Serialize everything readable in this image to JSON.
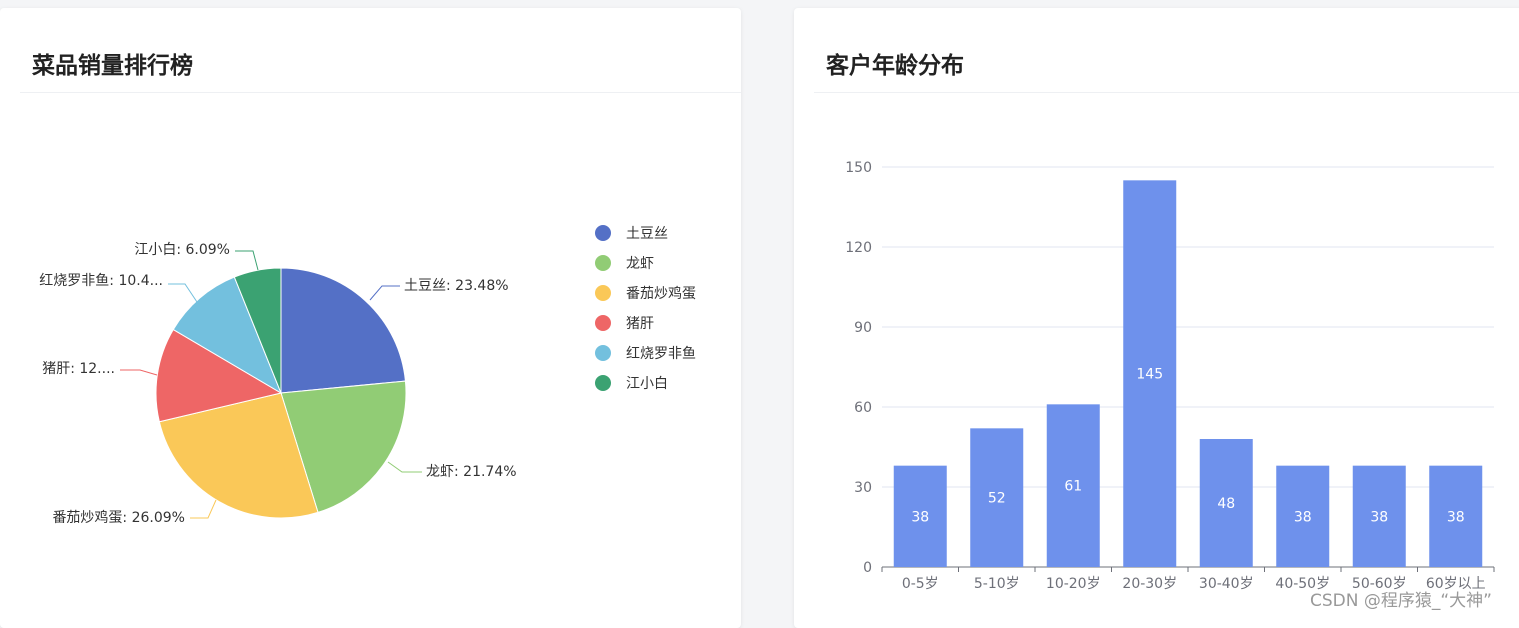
{
  "left_card": {
    "title": "菜品销量排行榜"
  },
  "right_card": {
    "title": "客户年龄分布"
  },
  "watermark": "CSDN @程序猿_“大神”",
  "chart_data": [
    {
      "type": "pie",
      "title": "菜品销量排行榜",
      "legend_position": "right",
      "slices": [
        {
          "name": "土豆丝",
          "value": 27,
          "percent": 23.48,
          "label": "土豆丝: 23.48%",
          "color": "#5470c6"
        },
        {
          "name": "龙虾",
          "value": 25,
          "percent": 21.74,
          "label": "龙虾: 21.74%",
          "color": "#91cc75"
        },
        {
          "name": "番茄炒鸡蛋",
          "value": 30,
          "percent": 26.09,
          "label": "番茄炒鸡蛋: 26.09%",
          "color": "#fac858"
        },
        {
          "name": "猪肝",
          "value": 14,
          "percent": 12.17,
          "label": "猪肝: 12....",
          "color": "#ee6666"
        },
        {
          "name": "红烧罗非鱼",
          "value": 12,
          "percent": 10.43,
          "label": "红烧罗非鱼: 10.4...",
          "color": "#73c0de"
        },
        {
          "name": "江小白",
          "value": 7,
          "percent": 6.09,
          "label": "江小白: 6.09%",
          "color": "#3ba272"
        }
      ]
    },
    {
      "type": "bar",
      "title": "客户年龄分布",
      "categories": [
        "0-5岁",
        "5-10岁",
        "10-20岁",
        "20-30岁",
        "30-40岁",
        "40-50岁",
        "50-60岁",
        "60岁以上"
      ],
      "values": [
        38,
        52,
        61,
        145,
        48,
        38,
        38,
        38
      ],
      "yticks": [
        "0",
        "30",
        "60",
        "90",
        "120",
        "150"
      ],
      "ylim": [
        0,
        150
      ],
      "grid": true,
      "color": "#6e91ec"
    }
  ]
}
